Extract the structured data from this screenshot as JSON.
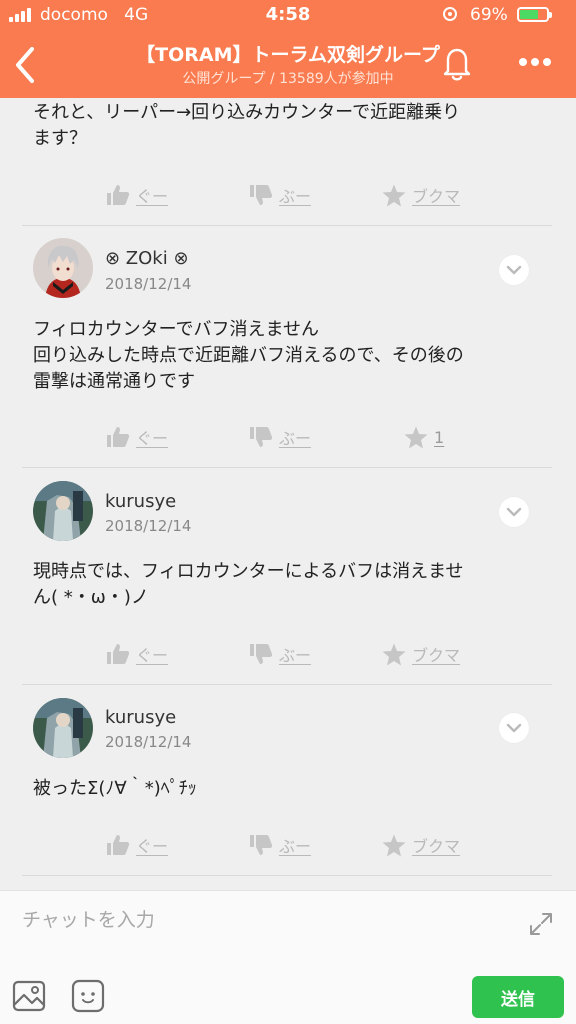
{
  "status_bar": {
    "carrier": "docomo",
    "network": "4G",
    "time": "4:58",
    "battery_percent": "69%",
    "battery_level": 0.69,
    "signal_bars": 4
  },
  "header": {
    "title": "【TORAM】トーラム双剣グループ",
    "subtitle": "公開グループ / 13589人が参加中",
    "icons": {
      "back": "chevron-left-icon",
      "bell": "bell-icon",
      "more": "more-dots-icon"
    },
    "bg_color": "#f97b4f"
  },
  "top_post": {
    "text": "それと、リーパー→回り込みカウンターで近距離乗り\nます？",
    "reactions": {
      "good": "ぐー",
      "boo": "ぶー",
      "bookmark": "ブクマ"
    }
  },
  "posts": [
    {
      "username": "⊗ ZOki ⊗",
      "date": "2018/12/14",
      "text": "フィロカウンターでバフ消えません\n回り込みした時点で近距離バフ消えるので、その後の\n雷撃は通常通りです",
      "reactions": {
        "good": "ぐー",
        "boo": "ぶー",
        "bookmark": "1"
      }
    },
    {
      "username": "kurusye",
      "date": "2018/12/14",
      "text": "現時点では、フィロカウンターによるバフは消えませ\nん( *・ω・)ノ",
      "reactions": {
        "good": "ぐー",
        "boo": "ぶー",
        "bookmark": "ブクマ"
      }
    },
    {
      "username": "kurusye",
      "date": "2018/12/14",
      "text": "被ったΣ(ﾉ∀｀*)ﾍﾟﾁｯ",
      "reactions": {
        "good": "ぐー",
        "boo": "ぶー",
        "bookmark": "ブクマ"
      }
    }
  ],
  "input": {
    "placeholder": "チャットを入力",
    "value": "",
    "send_label": "送信",
    "send_color": "#2fc24e",
    "icons": {
      "expand": "expand-arrows-icon",
      "image": "image-icon",
      "sticker": "sticker-face-icon"
    }
  }
}
